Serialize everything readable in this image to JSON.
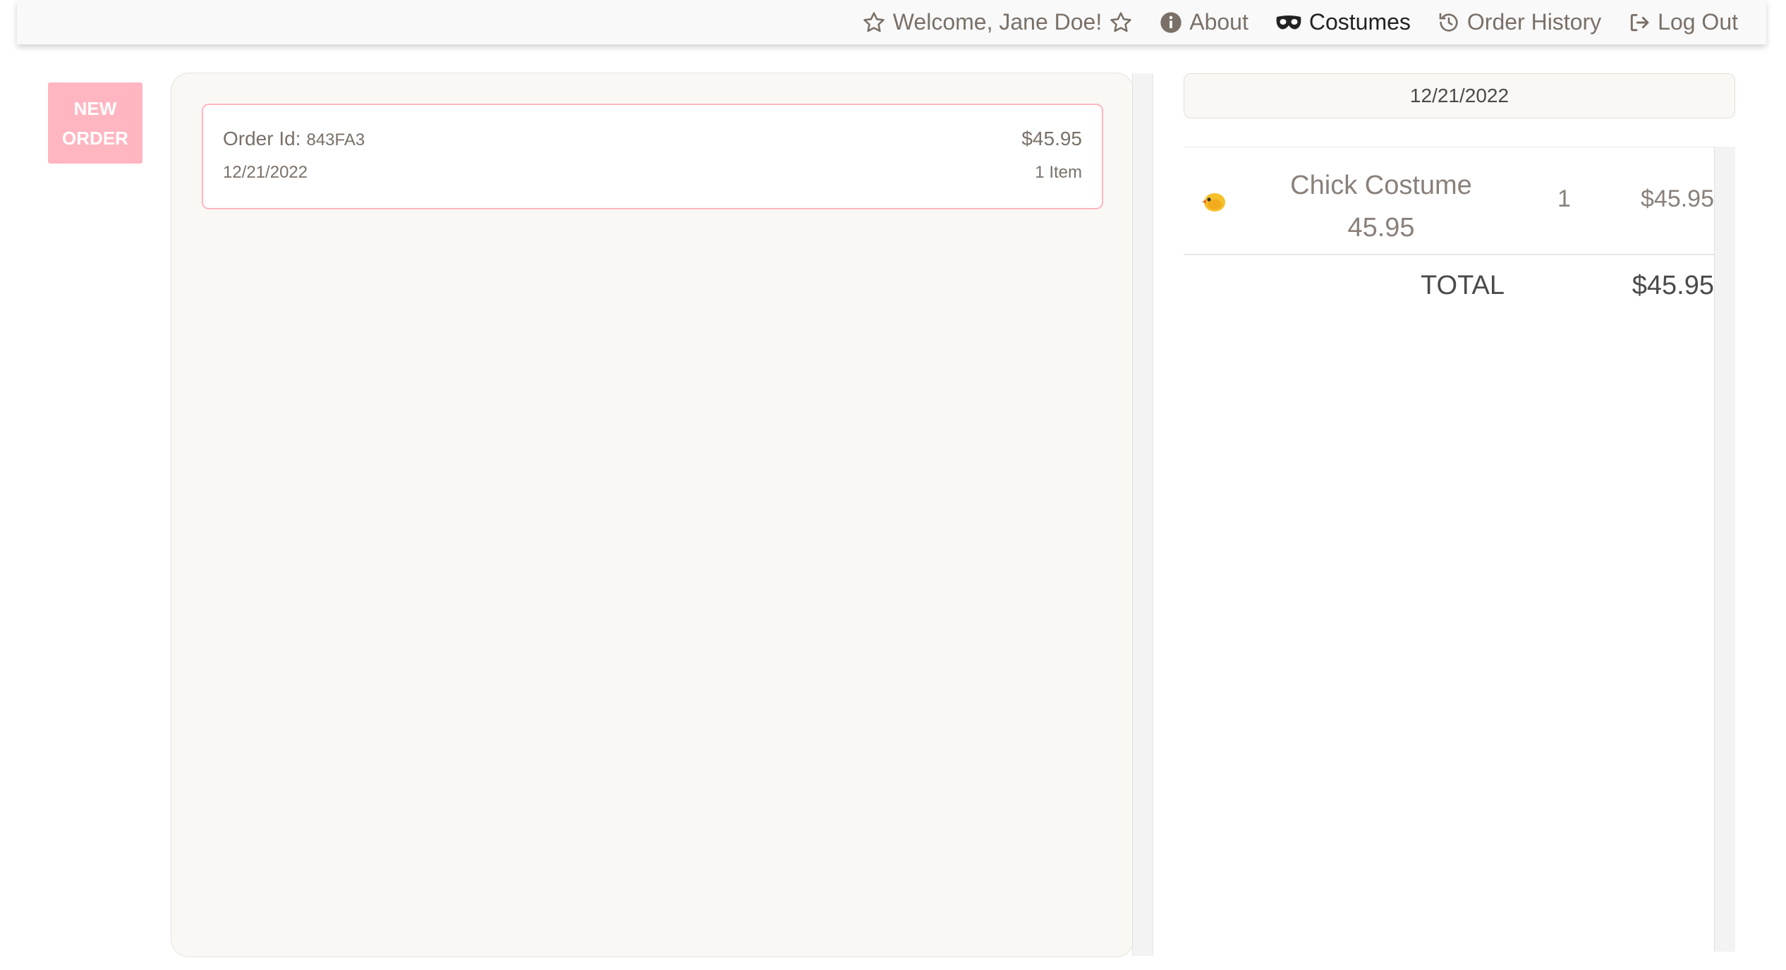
{
  "nav": {
    "welcome": "Welcome, Jane Doe!",
    "about": "About",
    "costumes": "Costumes",
    "order_history": "Order History",
    "logout": "Log Out",
    "active_item": "Costumes"
  },
  "sidebar": {
    "new_order_line1": "NEW",
    "new_order_line2": "ORDER",
    "button_color": "#ffb6c1"
  },
  "orders": [
    {
      "id_label": "Order Id:",
      "id": "843FA3",
      "total": "$45.95",
      "date": "12/21/2022",
      "item_count": "1 Item"
    }
  ],
  "detail": {
    "date": "12/21/2022",
    "items": [
      {
        "icon": "chick-icon",
        "name": "Chick Costume",
        "unit_price": "45.95",
        "qty": "1",
        "line_total": "$45.95"
      }
    ],
    "total_label": "TOTAL",
    "total_value": "$45.95"
  },
  "colors": {
    "accent_pink": "#ffb6c1",
    "panel_bg": "#f9f8f5",
    "text_muted": "#7a7068"
  }
}
